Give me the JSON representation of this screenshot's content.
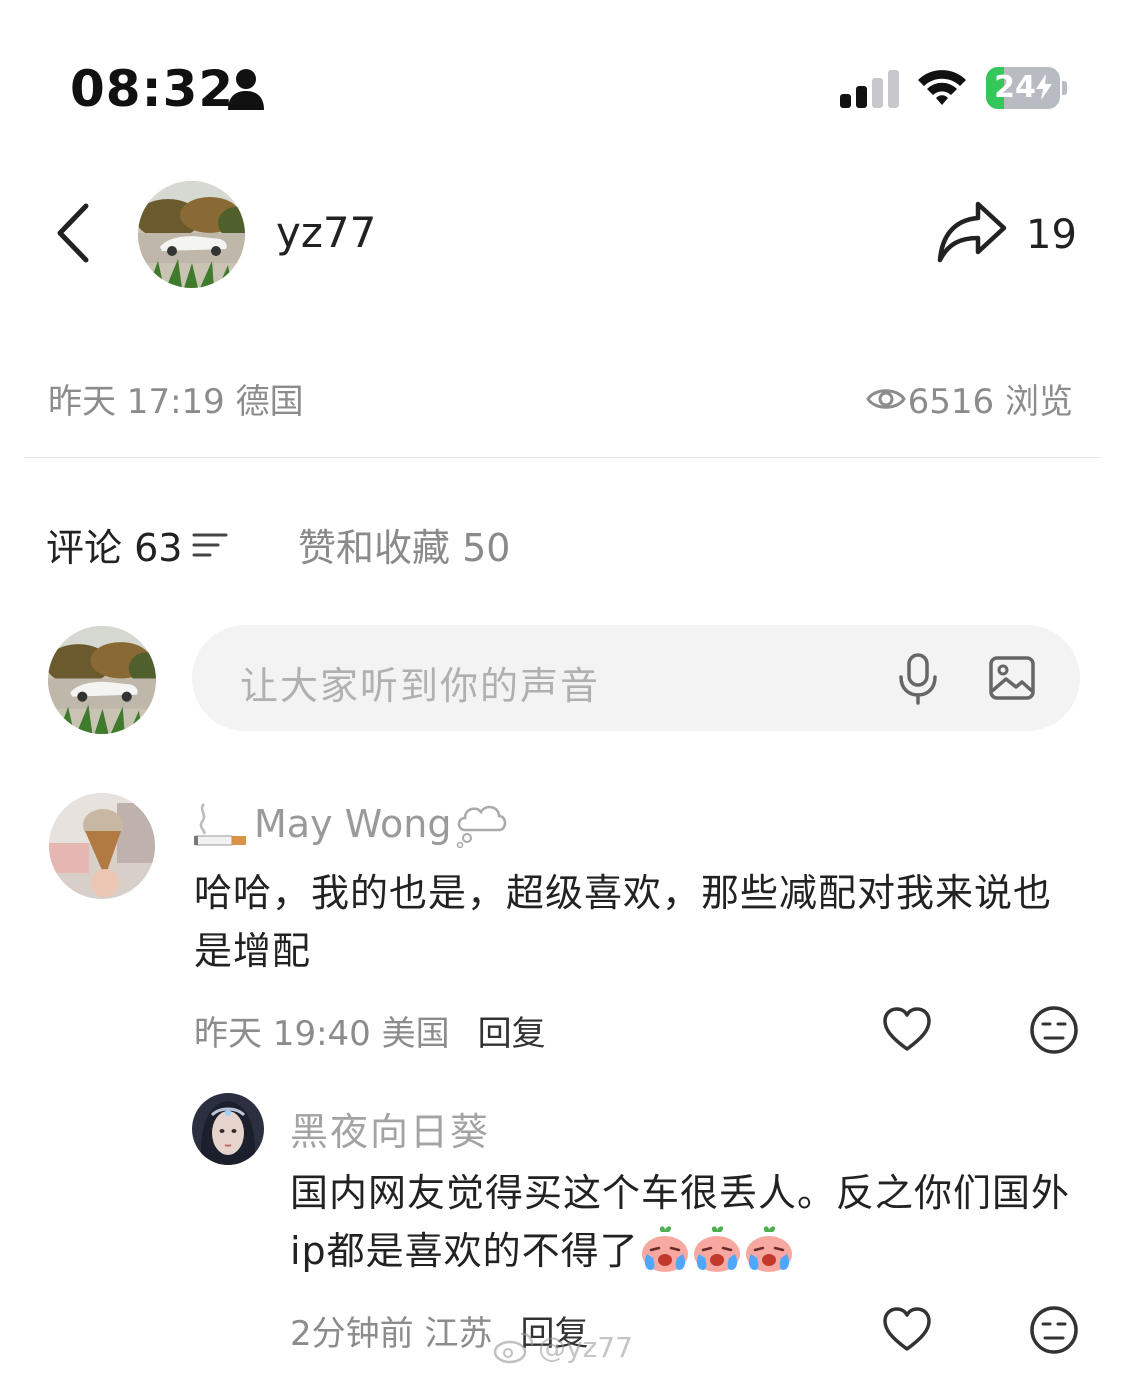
{
  "status_bar": {
    "time": "08:32",
    "battery": "24",
    "battery_level": 0.24,
    "icons": [
      "person-icon",
      "signal-icon",
      "wifi-icon",
      "charging-bolt-icon"
    ]
  },
  "header": {
    "username": "yz77",
    "share_count": "19",
    "icons": [
      "back-chevron-icon",
      "share-arrow-icon"
    ]
  },
  "post_meta": {
    "time_location": "昨天 17:19 德国",
    "views": "6516 浏览"
  },
  "tabs": {
    "comments": "评论 63",
    "likes_favorites": "赞和收藏 50"
  },
  "comment_input": {
    "placeholder": "让大家听到你的声音",
    "icons": [
      "microphone-icon",
      "image-icon"
    ]
  },
  "comments": [
    {
      "author": "May Wong",
      "text": "哈哈，我的也是，超级喜欢，那些减配对我来说也是增配",
      "time_location": "昨天 19:40 美国",
      "reply_label": "回复",
      "replies": [
        {
          "author": "黑夜向日葵",
          "text": "国内网友觉得买这个车很丢人。反之你们国外ip都是喜欢的不得了",
          "time_location": "2分钟前 江苏",
          "reply_label": "回复"
        }
      ]
    }
  ],
  "watermark": "@yz77",
  "colors": {
    "text_primary": "#222222",
    "text_secondary": "#8c8c8c",
    "battery_green": "#34c759",
    "input_bg": "#f3f3f3"
  }
}
